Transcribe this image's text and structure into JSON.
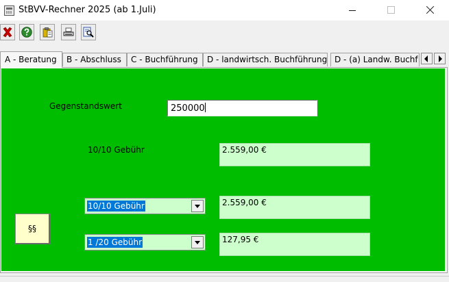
{
  "window": {
    "title": "StBVV-Rechner 2025 (ab 1.Juli)"
  },
  "toolbar": {
    "buttons": [
      {
        "icon": "close-x-icon",
        "color": "#c80000"
      },
      {
        "icon": "help-icon",
        "color": "#2e8b2e"
      },
      {
        "icon": "clipboard-icon",
        "color": "#d8b400"
      },
      {
        "icon": "printer-icon",
        "color": "#333333"
      },
      {
        "icon": "search-page-icon",
        "color": "#1a3fa0"
      }
    ]
  },
  "tabs": [
    {
      "label": "A - Beratung",
      "active": true
    },
    {
      "label": "B - Abschluss",
      "active": false
    },
    {
      "label": "C - Buchführung",
      "active": false
    },
    {
      "label": "D - landwirtsch. Buchführung",
      "active": false
    },
    {
      "label": "D - (a) Landw. Buchf",
      "active": false
    }
  ],
  "form": {
    "gegenstandswert_label": "Gegenstandswert",
    "gegenstandswert_value": "250000",
    "gebuehr_label": "10/10 Gebühr",
    "gebuehr_result": "2.559,00 €",
    "select1": {
      "selected": "10/10 Gebühr",
      "result": "2.559,00 €"
    },
    "select2": {
      "selected": "1 /20 Gebühr",
      "result": "127,95 €"
    },
    "paragraph_button": "§§"
  },
  "colors": {
    "panel_background": "#00bd00",
    "result_background": "#ccffcc",
    "paragraph_button_background": "#ffffcc",
    "selection_highlight": "#0078d7"
  }
}
